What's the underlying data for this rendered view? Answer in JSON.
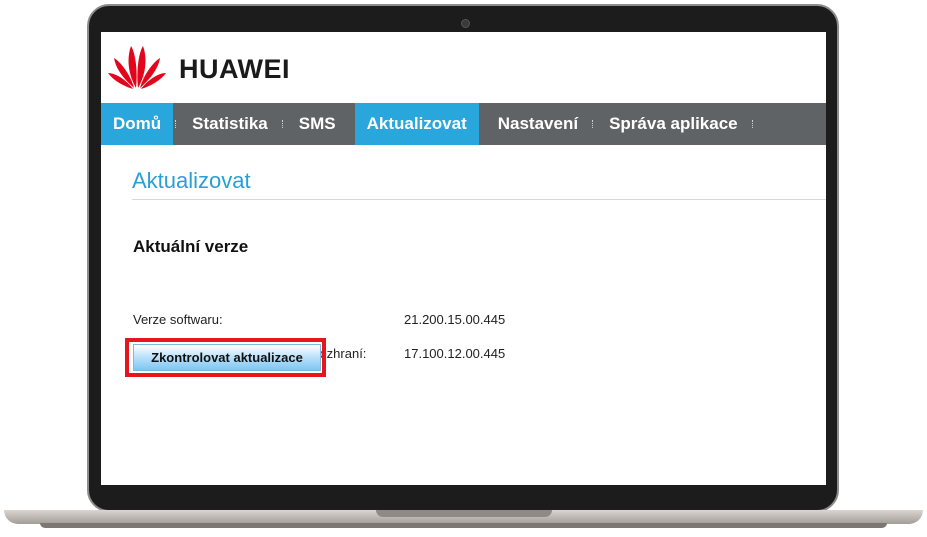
{
  "brand": {
    "name": "HUAWEI",
    "logo_icon": "huawei-petals-icon",
    "logo_color": "#e3051b"
  },
  "nav": {
    "items": [
      {
        "label": "Domů",
        "active": true
      },
      {
        "label": "Statistika",
        "active": false
      },
      {
        "label": "SMS",
        "active": false
      },
      {
        "label": "Aktualizovat",
        "active": true
      },
      {
        "label": "Nastavení",
        "active": false
      },
      {
        "label": "Správa aplikace",
        "active": false
      }
    ],
    "active_color": "#29a6dc",
    "bar_color": "#5f6366"
  },
  "page": {
    "title": "Aktualizovat",
    "section_title": "Aktuální verze",
    "rows": [
      {
        "label": "Verze softwaru:",
        "value": "21.200.15.00.445"
      },
      {
        "label": "Verze webového uživatelského rozhraní:",
        "value": "17.100.12.00.445"
      }
    ],
    "check_button": "Zkontrolovat aktualizace",
    "highlight_color": "#e6161c"
  }
}
